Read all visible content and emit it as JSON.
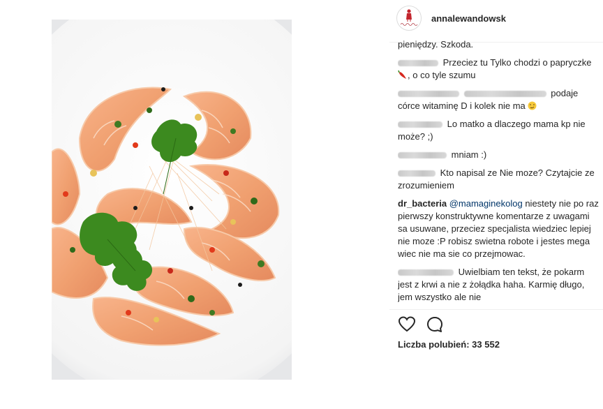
{
  "post": {
    "username": "annalewandowsk",
    "photo_icon": "food-photo-shrimp",
    "likes_text": "Liczba polubień: 33 552"
  },
  "comments": [
    {
      "author": "",
      "text": "pieniędzy. Szkoda."
    },
    {
      "author": "",
      "text_a": "Przeciez tu Tylko chodzi o papryczke",
      "text_b": ", o co tyle szumu"
    },
    {
      "author": "",
      "mention": "",
      "text": "podaje córce witaminę D i kolek nie ma"
    },
    {
      "author": "",
      "text": "Lo matko a dlaczego mama kp nie może? ;)"
    },
    {
      "author": "",
      "text": "mniam :)"
    },
    {
      "author": "",
      "text": "Kto napisal ze Nie moze? Czytajcie ze zrozumieniem"
    },
    {
      "author": "dr_bacteria",
      "mention": "@mamaginekolog",
      "text": "niestety nie po raz pierwszy konstruktywne komentarze z uwagami sa usuwane, przeciez specjalista wiedziec lepiej nie moze :P robisz swietna robote i jestes mega wiec nie ma sie co przejmowac."
    },
    {
      "author": "",
      "text": "Uwielbiam ten tekst, że pokarm jest z krwi a nie z żołądka haha. Karmię długo, jem wszystko ale nie"
    }
  ],
  "icons": {
    "like": "heart-icon",
    "comment": "speech-bubble-icon"
  },
  "colors": {
    "text": "#262626",
    "mention": "#003569",
    "divider": "#efefef"
  }
}
